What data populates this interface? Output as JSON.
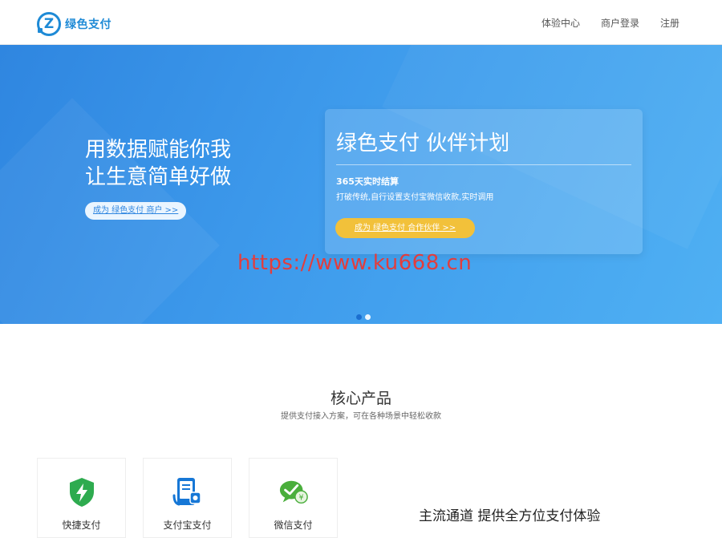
{
  "brand": {
    "logo_letter": "Z",
    "logo_text": "绿色支付"
  },
  "nav": {
    "items": [
      "体验中心",
      "商户登录",
      "注册"
    ]
  },
  "hero": {
    "headline_line1": "用数据赋能你我",
    "headline_line2": "让生意简单好做",
    "merchant_cta": "成为 绿色支付 商户 >>",
    "card": {
      "title": "绿色支付 伙伴计划",
      "subtitle": "365天实时结算",
      "description": "打破传统,自行设置支付宝微信收款,实时调用",
      "partner_cta": "成为 绿色支付 合作伙伴 >>"
    },
    "watermark": "https://www.ku668.cn",
    "carousel_active_index": 0
  },
  "products": {
    "title": "核心产品",
    "subtitle": "提供支付接入方案，可在各种场景中轻松收款",
    "items": [
      {
        "label": "快捷支付",
        "icon": "lightning-shield-icon",
        "color": "#2eab4f"
      },
      {
        "label": "支付宝支付",
        "icon": "phone-payment-icon",
        "color": "#1677d6"
      },
      {
        "label": "微信支付",
        "icon": "wechat-coin-icon",
        "color": "#4aae3c"
      }
    ],
    "mainstream_heading": "主流通道 提供全方位支付体验"
  }
}
